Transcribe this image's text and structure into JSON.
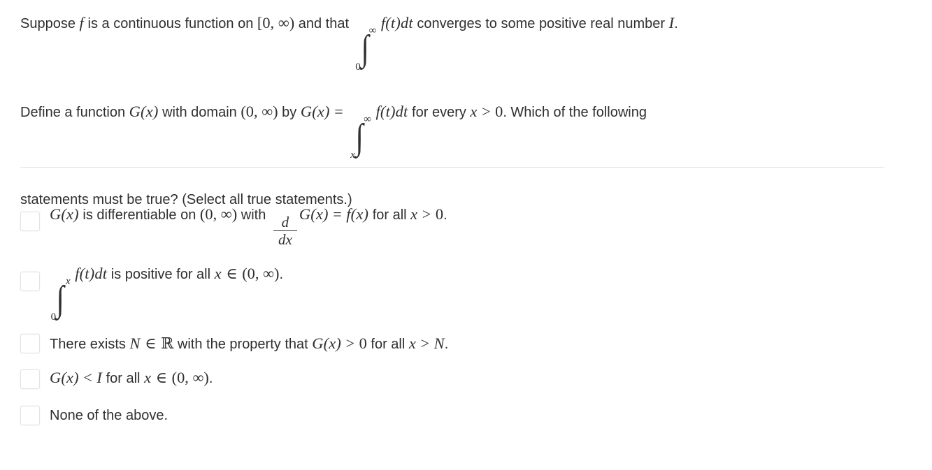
{
  "question": {
    "line1": {
      "part_a": "Suppose",
      "var_f": "f",
      "part_b": "is a continuous function on",
      "interval": "[0, ∞)",
      "part_c": "and that",
      "integral": {
        "lower": "0",
        "upper": "∞",
        "integrand": "f(t)dt"
      },
      "part_d": "converges to some positive real number",
      "var_I": "I",
      "period": "."
    },
    "line2": {
      "part_a": "Define a function",
      "func_G": "G(x)",
      "part_b": "with domain",
      "interval": "(0, ∞)",
      "part_c": "by",
      "func_G2": "G(x)",
      "equals": "=",
      "integral": {
        "lower": "x",
        "upper": "∞",
        "integrand": "f(t)dt"
      },
      "part_d": "for every",
      "var_x": "x",
      "gt": ">",
      "zero": "0",
      "part_e": ". Which of the following"
    },
    "line3": "statements must be true? (Select all true statements.)"
  },
  "options": [
    {
      "id": "option-differentiable",
      "checked": false,
      "segments": {
        "func_G": "G(x)",
        "t1": "is differentiable on",
        "interval": "(0, ∞)",
        "t2": "with",
        "frac_num": "d",
        "frac_den": "dx",
        "func_G2": "G(x)",
        "equals": "=",
        "func_f": "f(x)",
        "t3": "for all",
        "var_x": "x",
        "gt": ">",
        "zero": "0",
        "period": "."
      }
    },
    {
      "id": "option-integral-positive",
      "checked": false,
      "segments": {
        "integral": {
          "lower": "0",
          "upper": "x",
          "integrand": "f(t)dt"
        },
        "t1": "is positive for all",
        "var_x": "x",
        "elem": "∈",
        "interval": "(0, ∞)",
        "period": "."
      }
    },
    {
      "id": "option-exists-N",
      "checked": false,
      "segments": {
        "t1": "There exists",
        "var_N": "N",
        "elem": "∈",
        "reals": "ℝ",
        "t2": "with the property that",
        "func_G": "G(x)",
        "gt": ">",
        "zero": "0",
        "t3": "for all",
        "var_x": "x",
        "gt2": ">",
        "var_N2": "N",
        "period": "."
      }
    },
    {
      "id": "option-G-less-than-I",
      "checked": false,
      "segments": {
        "func_G": "G(x)",
        "lt": "<",
        "var_I": "I",
        "t1": "for all",
        "var_x": "x",
        "elem": "∈",
        "interval": "(0, ∞)",
        "period": "."
      }
    },
    {
      "id": "option-none-of-the-above",
      "checked": false,
      "segments": {
        "t1": "None of the above."
      }
    }
  ],
  "symbols": {
    "integral_glyph": "∫"
  },
  "colors": {
    "text": "#2f2f2f",
    "divider": "#e4e4e4",
    "checkbox_border": "#e3e3e3",
    "background": "#ffffff"
  }
}
